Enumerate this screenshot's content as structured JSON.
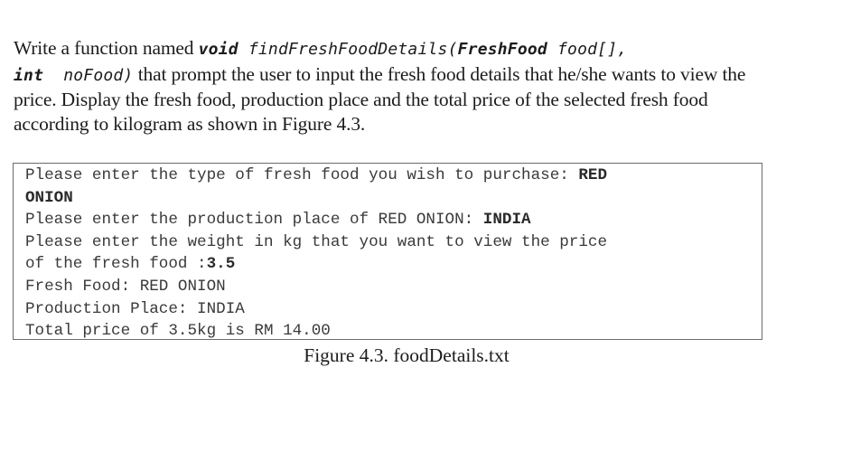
{
  "question": {
    "intro": "Write a function named ",
    "signature": {
      "return_type": "void",
      "function_name": "findFreshFoodDetails(",
      "param1_type": "FreshFood",
      "param1_name": "food[],",
      "param2_type": "int",
      "param2_name": "noFood)"
    },
    "body": " that prompt the user to input the fresh food details that he/she wants to view the price. Display the fresh food, production place and the total price of the selected fresh food according to kilogram as shown in Figure 4.3."
  },
  "console": {
    "lines": [
      {
        "prompt": "Please enter the type of fresh food you wish to purchase: ",
        "input": "RED"
      },
      {
        "prompt": "",
        "input": "ONION"
      },
      {
        "prompt": "Please enter the production place of RED ONION: ",
        "input": "INDIA"
      },
      {
        "prompt": "Please enter the weight in kg that you want to view the price",
        "input": ""
      },
      {
        "prompt": "of the fresh food :",
        "input": "3.5"
      },
      {
        "prompt": "Fresh Food: RED ONION",
        "input": ""
      },
      {
        "prompt": "Production Place: INDIA",
        "input": ""
      },
      {
        "prompt": "Total price of 3.5kg is RM 14.00",
        "input": ""
      }
    ]
  },
  "figure": {
    "caption": "Figure 4.3. foodDetails.txt"
  }
}
